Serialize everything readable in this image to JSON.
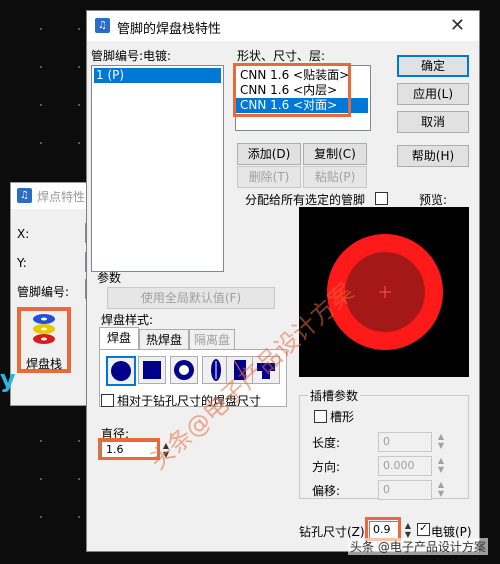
{
  "background": {
    "dialog_title": "焊点特性",
    "x_label": "X:",
    "y_label": "Y:",
    "pin_label": "管脚编号:",
    "stack_label": "焊盘栈",
    "side_text": "y"
  },
  "dialog": {
    "title": "管脚的焊盘栈特性",
    "pin_list_header": "管脚编号:电镀:",
    "pin_items": [
      "1 (P)"
    ],
    "shape_header": "形状、尺寸、层:",
    "shape_items": [
      "CNN 1.6 <贴装面>",
      "CNN 1.6 <内层>",
      "CNN 1.6 <对面>"
    ],
    "buttons": {
      "ok": "确定",
      "apply": "应用(L)",
      "cancel": "取消",
      "help": "帮助(H)",
      "add": "添加(D)",
      "copy": "复制(C)",
      "delete": "删除(T)",
      "paste": "粘贴(P)",
      "use_default": "使用全局默认值(F)"
    },
    "assign_all": "分配给所有选定的管脚",
    "preview_label": "预览:",
    "params_label": "参数",
    "pad_style_label": "焊盘样式:",
    "tabs": [
      "焊盘",
      "热焊盘",
      "隔离盘"
    ],
    "relative_size": "相对于钻孔尺寸的焊盘尺寸",
    "diameter_label": "直径:",
    "diameter_value": "1.6",
    "slot": {
      "title": "插槽参数",
      "slot_checkbox": "槽形",
      "length_label": "长度:",
      "length_value": "0",
      "direction_label": "方向:",
      "direction_value": "0.000",
      "offset_label": "偏移:",
      "offset_value": "0"
    },
    "drill_label": "钻孔尺寸(Z)",
    "drill_value": "0.9",
    "plated_label": "电镀(P)"
  },
  "watermark": "头条 @电子产品设计方案",
  "overlay_watermark": "头条@电子产品设计方案",
  "colors": {
    "accent": "#e86a3a",
    "selection": "#0078d7",
    "pad_outer": "#ff1a1a",
    "pad_inner": "#a41818"
  }
}
